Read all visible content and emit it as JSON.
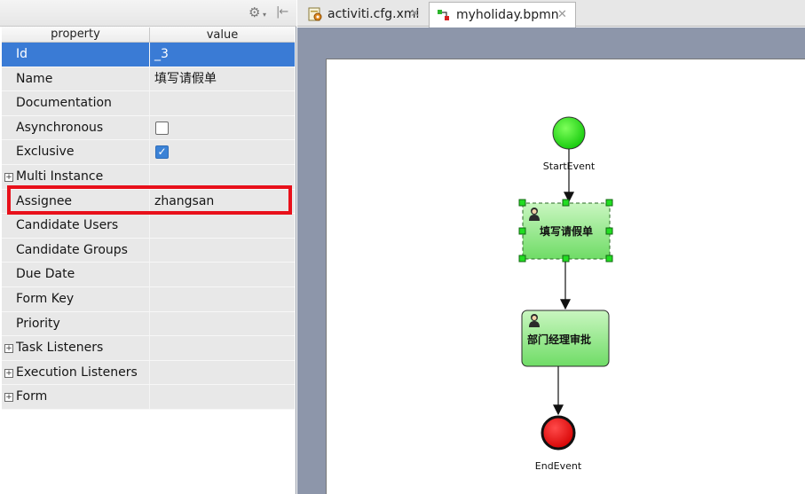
{
  "properties_panel": {
    "header": {
      "property": "property",
      "value": "value"
    },
    "rows": [
      {
        "property": "Id",
        "value": "_3"
      },
      {
        "property": "Name",
        "value": "填写请假单"
      },
      {
        "property": "Documentation",
        "value": ""
      },
      {
        "property": "Asynchronous",
        "value": ""
      },
      {
        "property": "Exclusive",
        "value": ""
      },
      {
        "property": "Multi Instance",
        "value": ""
      },
      {
        "property": "Assignee",
        "value": "zhangsan"
      },
      {
        "property": "Candidate Users",
        "value": ""
      },
      {
        "property": "Candidate Groups",
        "value": ""
      },
      {
        "property": "Due Date",
        "value": ""
      },
      {
        "property": "Form Key",
        "value": ""
      },
      {
        "property": "Priority",
        "value": ""
      },
      {
        "property": "Task Listeners",
        "value": ""
      },
      {
        "property": "Execution Listeners",
        "value": ""
      },
      {
        "property": "Form",
        "value": ""
      }
    ],
    "checkboxes": {
      "asynchronous": false,
      "exclusive": true
    },
    "selected_row": "Id",
    "highlighted_row": "Assignee"
  },
  "tabs": [
    {
      "label": "activiti.cfg.xml",
      "active": false
    },
    {
      "label": "myholiday.bpmn",
      "active": true
    }
  ],
  "diagram": {
    "start_event": "StartEvent",
    "task_1": "填写请假单",
    "task_2": "部门经理审批",
    "end_event": "EndEvent"
  },
  "colors": {
    "selection": "#3a7bd5",
    "highlight": "#e8101a",
    "start_event": "#22e010",
    "end_event": "#ee0000",
    "task_fill": "#8fe88a",
    "editor_bg": "#8d96aa"
  }
}
